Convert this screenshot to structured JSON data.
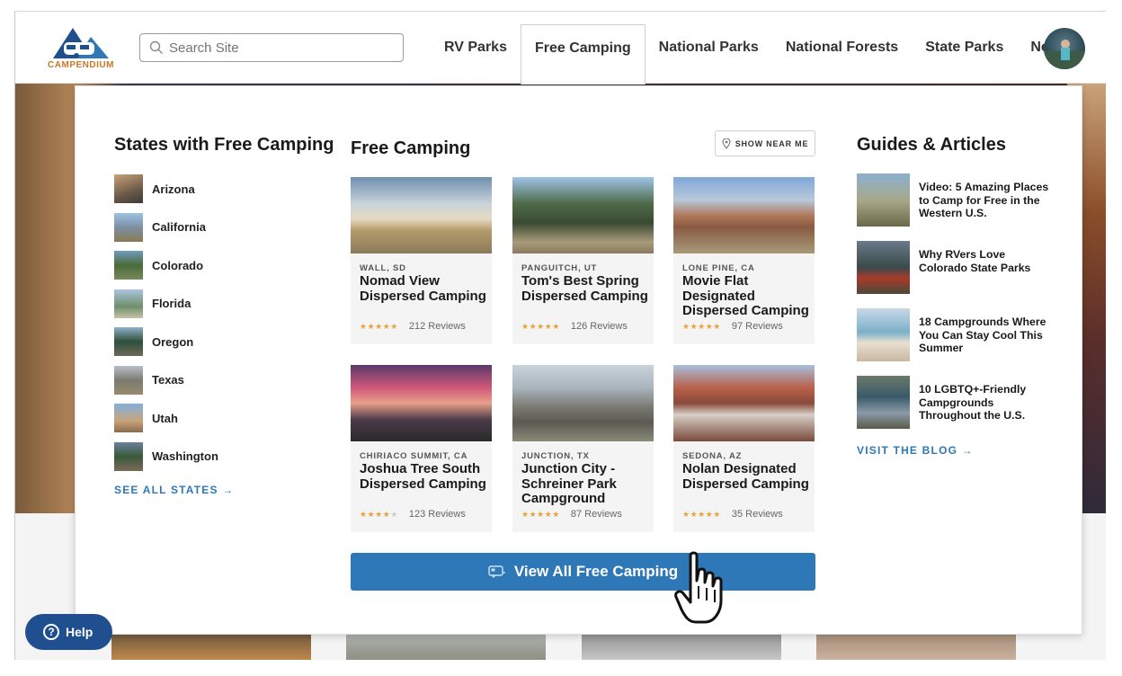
{
  "header": {
    "logo_text": "CAMPENDIUM",
    "search_placeholder": "Search Site",
    "nav": [
      {
        "label": "RV Parks"
      },
      {
        "label": "Free Camping"
      },
      {
        "label": "National Parks"
      },
      {
        "label": "National Forests"
      },
      {
        "label": "State Parks"
      },
      {
        "label": "News"
      }
    ],
    "active_nav": "Free Camping"
  },
  "states": {
    "title": "States with Free Camping",
    "items": [
      {
        "label": "Arizona"
      },
      {
        "label": "California"
      },
      {
        "label": "Colorado"
      },
      {
        "label": "Florida"
      },
      {
        "label": "Oregon"
      },
      {
        "label": "Texas"
      },
      {
        "label": "Utah"
      },
      {
        "label": "Washington"
      }
    ],
    "cta": "SEE ALL STATES →"
  },
  "free_camping": {
    "title": "Free Camping",
    "show_near_me": "SHOW NEAR ME",
    "cards": [
      {
        "location": "WALL, SD",
        "name": "Nomad View Dispersed Camping",
        "rating": 5,
        "reviews": "212 Reviews"
      },
      {
        "location": "PANGUITCH, UT",
        "name": "Tom's Best Spring Dispersed Camping",
        "rating": 5,
        "reviews": "126 Reviews"
      },
      {
        "location": "LONE PINE, CA",
        "name": "Movie Flat Designated Dispersed Camping",
        "rating": 5,
        "reviews": "97 Reviews"
      },
      {
        "location": "CHIRIACO SUMMIT, CA",
        "name": "Joshua Tree South Dispersed Camping",
        "rating": 4,
        "reviews": "123 Reviews"
      },
      {
        "location": "JUNCTION, TX",
        "name": "Junction City - Schreiner Park Campground",
        "rating": 5,
        "reviews": "87 Reviews"
      },
      {
        "location": "SEDONA, AZ",
        "name": "Nolan Designated Dispersed Camping",
        "rating": 5,
        "reviews": "35 Reviews"
      }
    ],
    "view_all": "View All Free Camping"
  },
  "guides": {
    "title": "Guides & Articles",
    "items": [
      {
        "title": "Video: 5 Amazing Places to Camp for Free in the Western U.S."
      },
      {
        "title": "Why RVers Love Colorado State Parks"
      },
      {
        "title": "18 Campgrounds Where You Can Stay Cool This Summer"
      },
      {
        "title": "10 LGBTQ+-Friendly Campgrounds Throughout the U.S."
      }
    ],
    "cta": "VISIT THE BLOG →"
  },
  "help": {
    "label": "Help"
  },
  "colors": {
    "accent": "#2e78b7",
    "logo_navy": "#1f4f8f",
    "logo_orange": "#c8782a",
    "star": "#e9a33a",
    "help_bg": "#1f4f8f"
  }
}
